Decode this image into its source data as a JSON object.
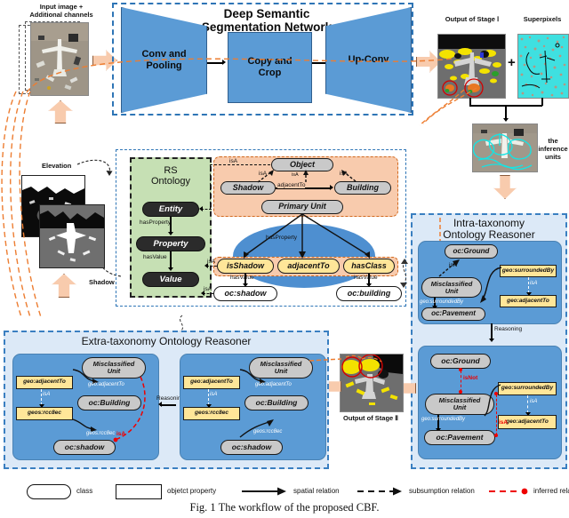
{
  "figure": {
    "caption": "Fig. 1 The workflow of the proposed CBF."
  },
  "stage1": {
    "input_label_line1": "Input image +",
    "input_label_line2": "Additional channels",
    "elevation_label": "Elevation",
    "shadow_label": "Shadow",
    "network_title_line1": "Deep Semantic",
    "network_title_line2": "Segmentation Network",
    "blocks": [
      {
        "id": "conv-pooling",
        "line1": "Conv and",
        "line2": "Pooling"
      },
      {
        "id": "copy-crop",
        "line1": "Copy and",
        "line2": "Crop"
      },
      {
        "id": "up-conv",
        "line1": "Up-Conv",
        "line2": ""
      }
    ],
    "output_stage1_label": "Output of Stage Ⅰ",
    "superpixels_label": "Superpixels",
    "plus_symbol": "+",
    "inference_units_line1": "the",
    "inference_units_line2": "inference",
    "inference_units_line3": "units"
  },
  "ontology": {
    "panel_title_line1": "RS",
    "panel_title_line2": "Ontology",
    "left_nodes": [
      {
        "id": "entity",
        "label": "Entity"
      },
      {
        "id": "property",
        "label": "Property"
      },
      {
        "id": "value",
        "label": "Value"
      }
    ],
    "left_edges": [
      {
        "id": "hasProperty",
        "label": "hasProperty"
      },
      {
        "id": "hasValue",
        "label": "hasValue"
      }
    ],
    "isa_labels": [
      "isA",
      "isA",
      "isA",
      "isA",
      "isA",
      "isA"
    ],
    "object_nodes": [
      {
        "id": "object",
        "label": "Object"
      },
      {
        "id": "shadow",
        "label": "Shadow"
      },
      {
        "id": "building",
        "label": "Building"
      },
      {
        "id": "primary-unit",
        "label": "Primary Unit"
      }
    ],
    "adjacentTo_label": "adjacentTo",
    "hasProperty_label": "hasProperty",
    "property_nodes": [
      {
        "id": "isShadow",
        "label": "isShadow"
      },
      {
        "id": "adjacentTo",
        "label": "adjacentTo"
      },
      {
        "id": "hasClass",
        "label": "hasClass"
      }
    ],
    "hasValue_labels": [
      "hasValue",
      "hasValue"
    ],
    "value_nodes": [
      {
        "id": "oc-shadow",
        "label": "oc:shadow"
      },
      {
        "id": "oc-building",
        "label": "oc:building"
      }
    ]
  },
  "intra": {
    "title_line1": "Intra-taxonomy",
    "title_line2": "Ontology Reasoner",
    "reasoning_label": "Reasoning",
    "top": {
      "ground": "oc:Ground",
      "misclassified_line1": "Misclassified",
      "misclassified_line2": "Unit",
      "pavement": "oc:Pavement",
      "surroundedBy_box": "geo:surroundedBy",
      "adjacentTo_box": "geo:adjacentTo",
      "isa_1": "isA",
      "isa_2": "isA",
      "surroundedBy_edge": "geo:surroundedBy"
    },
    "bottom": {
      "ground": "oc:Ground",
      "misclassified_line1": "Misclassified",
      "misclassified_line2": "Unit",
      "pavement": "oc:Pavement",
      "surroundedBy_box": "geo:surroundedBy",
      "adjacentTo_box": "geo:adjacentTo",
      "isNot_label": "isNot",
      "isa_1": "isA",
      "isa_2": "isA",
      "surroundedBy_edge": "geo:surroundedBy"
    }
  },
  "extra": {
    "title": "Extra-taxonomy Ontology Reasoner",
    "reasoning_label": "Reasoning",
    "left": {
      "misclassified_line1": "Misclassified",
      "misclassified_line2": "Unit",
      "building": "oc:Building",
      "shadow": "oc:shadow",
      "adjacentTo_box": "geo:adjacentTo",
      "rcc8ec_box": "geos:rcc8ec",
      "isa_label": "isA",
      "adjacentTo_edge": "geo:adjacentTo",
      "rcc8ec_edge": "geos:rcc8ec",
      "isa_inferred": "isA"
    },
    "right": {
      "misclassified_line1": "Misclassified",
      "misclassified_line2": "Unit",
      "building": "oc:Building",
      "shadow": "oc:shadow",
      "adjacentTo_box": "geo:adjacentTo",
      "rcc8ec_box": "geos:rcc8ec",
      "isa_label": "isA",
      "adjacentTo_edge": "geo:adjacentTo",
      "rcc8ec_edge": "geos:rcc8ec"
    },
    "output_stage2_label": "Output of Stage Ⅱ"
  },
  "legend": {
    "items": [
      {
        "id": "class",
        "label": "class",
        "glyph": "rounded-rect"
      },
      {
        "id": "object-property",
        "label": "objetct property",
        "glyph": "rect"
      },
      {
        "id": "spatial-relation",
        "label": "spatial relation",
        "glyph": "solid-arrow"
      },
      {
        "id": "subsumption-relation",
        "label": "subsumption relation",
        "glyph": "dashed-arrow"
      },
      {
        "id": "inferred-relation",
        "label": "inferred relation",
        "glyph": "red-dashed-dot"
      }
    ]
  },
  "colors": {
    "network_blue": "#5B9BD5",
    "panel_blue_light": "#DCE9F7",
    "ontology_green": "#C6E0B4",
    "object_orange": "#F8CBAD",
    "property_yellow": "#FFE699",
    "peach_arrow": "#F8CBAD",
    "inferred_red": "#EE0000",
    "dashed_border_blue": "#2E75B6"
  }
}
